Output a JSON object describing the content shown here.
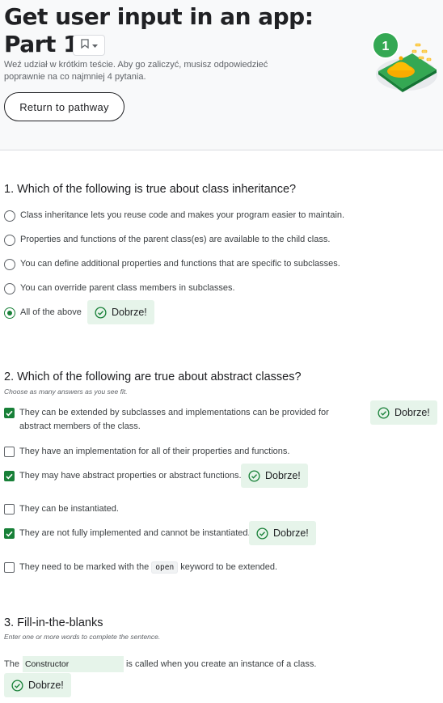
{
  "header": {
    "title_line1": "Get user input in an app:",
    "title_line2": "Part 1",
    "subtitle": "Weź udział w krótkim teście. Aby go zaliczyć, musisz odpowiedzieć poprawnie na co najmniej 4 pytania.",
    "return_button": "Return to pathway",
    "badge_number": "1",
    "accent_color": "#188038"
  },
  "feedback_label": "Dobrze!",
  "q1": {
    "title": "1. Which of the following is true about class inheritance?",
    "options": [
      "Class inheritance lets you reuse code and makes your program easier to maintain.",
      "Properties and functions of the parent class(es) are available to the child class.",
      "You can define additional properties and functions that are specific to subclasses.",
      "You can override parent class members in subclasses.",
      "All of the above"
    ],
    "selected_index": 4
  },
  "q2": {
    "title": "2. Which of the following are true about abstract classes?",
    "hint": "Choose as many answers as you see fit.",
    "options": [
      "They can be extended by subclasses and implementations can be provided for abstract members of the class.",
      "They have an implementation for all of their properties and functions.",
      "They may have abstract properties or abstract functions.",
      "They can be instantiated.",
      "They are not fully implemented and cannot be instantiated."
    ],
    "option6_before": "They need to be marked with the",
    "option6_code": "open",
    "option6_after": "keyword to be extended.",
    "checked": [
      true,
      false,
      true,
      false,
      true,
      false
    ]
  },
  "q3": {
    "title": "3. Fill-in-the-blanks",
    "hint": "Enter one or more words to complete the sentence.",
    "before": "The",
    "answer": "Constructor",
    "after": "is called when you create an instance of a class."
  }
}
